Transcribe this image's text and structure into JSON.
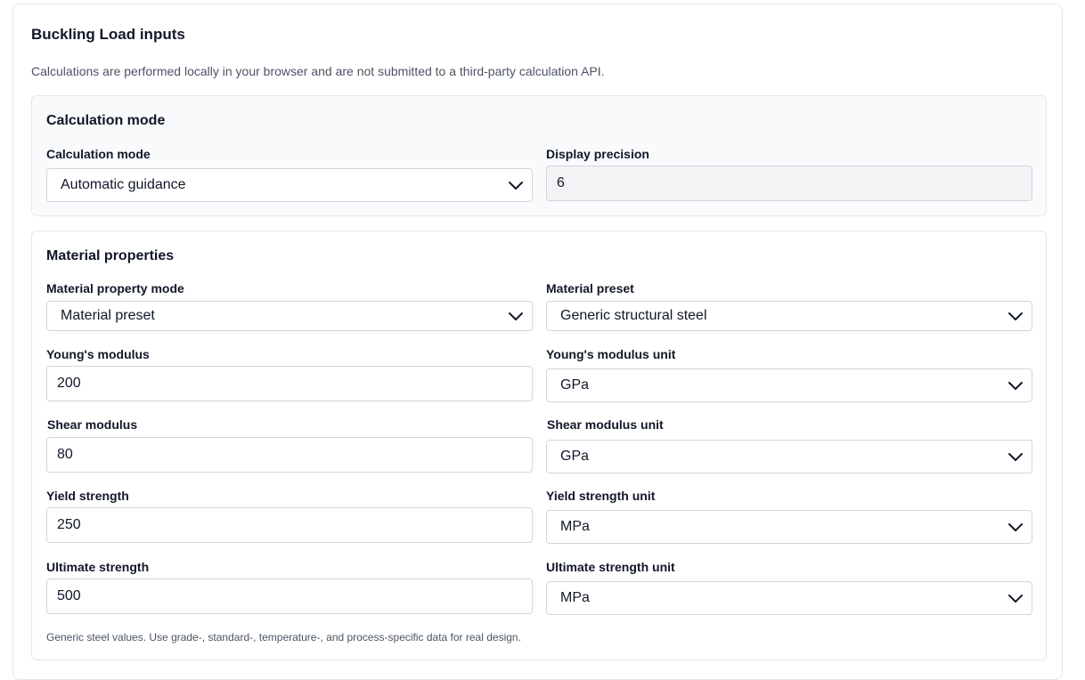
{
  "form": {
    "title": "Buckling Load inputs",
    "note": "Calculations are performed locally in your browser and are not submitted to a third-party calculation API."
  },
  "calc_mode_section": {
    "title": "Calculation mode",
    "mode": {
      "label": "Calculation mode",
      "value": "Automatic guidance"
    },
    "precision": {
      "label": "Display precision",
      "value": "6"
    }
  },
  "material_section": {
    "title": "Material properties",
    "property_mode": {
      "label": "Material property mode",
      "value": "Material preset"
    },
    "preset": {
      "label": "Material preset",
      "value": "Generic structural steel"
    },
    "youngs_modulus": {
      "label": "Young's modulus",
      "value": "200"
    },
    "youngs_modulus_unit": {
      "label": "Young's modulus unit",
      "value": "GPa"
    },
    "shear_modulus": {
      "label": "Shear modulus",
      "value": "80"
    },
    "shear_modulus_unit": {
      "label": "Shear modulus unit",
      "value": "GPa"
    },
    "yield_strength": {
      "label": "Yield strength",
      "value": "250"
    },
    "yield_strength_unit": {
      "label": "Yield strength unit",
      "value": "MPa"
    },
    "ultimate_strength": {
      "label": "Ultimate strength",
      "value": "500"
    },
    "ultimate_strength_unit": {
      "label": "Ultimate strength unit",
      "value": "MPa"
    },
    "footnote": "Generic steel values. Use grade-, standard-, temperature-, and process-specific data for real design."
  },
  "icons": {
    "dropdown": "chevron-down-icon"
  }
}
